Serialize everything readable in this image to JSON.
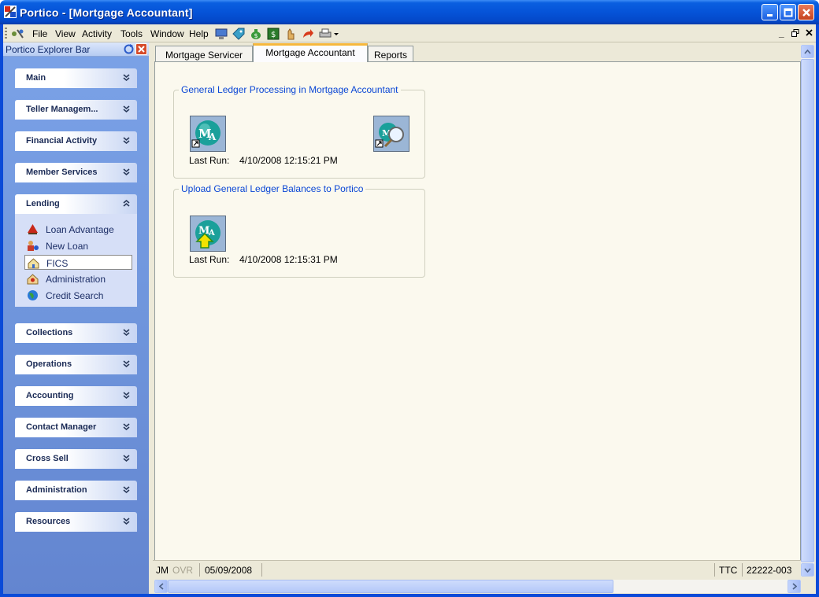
{
  "window": {
    "title": "Portico - [Mortgage Accountant]"
  },
  "menu": {
    "items": [
      "File",
      "View",
      "Activity",
      "Tools",
      "Window",
      "Help"
    ],
    "mdi_controls": [
      "_",
      "̱̲▫",
      "x"
    ]
  },
  "explorer": {
    "title": "Portico Explorer Bar",
    "groups": [
      {
        "label": "Main",
        "expanded": false
      },
      {
        "label": "Teller Managem...",
        "expanded": false
      },
      {
        "label": "Financial Activity",
        "expanded": false
      },
      {
        "label": "Member Services",
        "expanded": false
      },
      {
        "label": "Lending",
        "expanded": true
      },
      {
        "label": "Collections",
        "expanded": false
      },
      {
        "label": "Operations",
        "expanded": false
      },
      {
        "label": "Accounting",
        "expanded": false
      },
      {
        "label": "Contact Manager",
        "expanded": false
      },
      {
        "label": "Cross Sell",
        "expanded": false
      },
      {
        "label": "Administration",
        "expanded": false
      },
      {
        "label": "Resources",
        "expanded": false
      }
    ],
    "lending_tasks": [
      {
        "label": "Loan Advantage",
        "icon": "loan-advantage-icon"
      },
      {
        "label": "New Loan",
        "icon": "new-loan-icon"
      },
      {
        "label": "FICS",
        "icon": "fics-icon",
        "selected": true
      },
      {
        "label": "Administration",
        "icon": "administration-icon"
      },
      {
        "label": "Credit Search",
        "icon": "globe-icon"
      }
    ]
  },
  "tabs": [
    {
      "label": "Mortgage Servicer",
      "active": false
    },
    {
      "label": "Mortgage Accountant",
      "active": true
    },
    {
      "label": "Reports",
      "active": false
    }
  ],
  "sections": [
    {
      "title": "General Ledger Processing in Mortgage Accountant",
      "last_run_label": "Last Run:",
      "last_run_value": "4/10/2008 12:15:21 PM"
    },
    {
      "title": "Upload General Ledger Balances to Portico",
      "last_run_label": "Last Run:",
      "last_run_value": "4/10/2008 12:15:31 PM"
    }
  ],
  "status": {
    "user": "JM",
    "ovr": "OVR",
    "date": "05/09/2008",
    "ttc": "TTC",
    "code": "22222-003"
  },
  "colors": {
    "title_bar": "#0553d8",
    "section_title": "#0a46d5",
    "panel_bg": "#fbf9ee",
    "active_tab_accent": "#f6b73c"
  }
}
